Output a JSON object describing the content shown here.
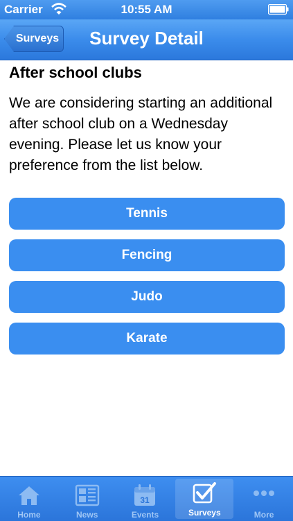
{
  "status_bar": {
    "carrier": "Carrier",
    "time": "10:55 AM"
  },
  "nav": {
    "back_label": "Surveys",
    "title": "Survey Detail"
  },
  "survey": {
    "title": "After school clubs",
    "description": "We are considering starting an additional after school club on a Wednesday evening. Please let us know your preference from the list below.",
    "options": [
      "Tennis",
      "Fencing",
      "Judo",
      "Karate"
    ]
  },
  "tabs": [
    {
      "label": "Home",
      "icon": "home-icon",
      "active": false
    },
    {
      "label": "News",
      "icon": "news-icon",
      "active": false
    },
    {
      "label": "Events",
      "icon": "calendar-icon",
      "calendar_day": "31",
      "active": false
    },
    {
      "label": "Surveys",
      "icon": "checkbox-icon",
      "active": true
    },
    {
      "label": "More",
      "icon": "more-icon",
      "active": false
    }
  ],
  "colors": {
    "accent": "#3a8ef0",
    "bar": "#2f7fe0",
    "tab_inactive": "#9fc6f5",
    "tab_active": "#ffffff"
  }
}
